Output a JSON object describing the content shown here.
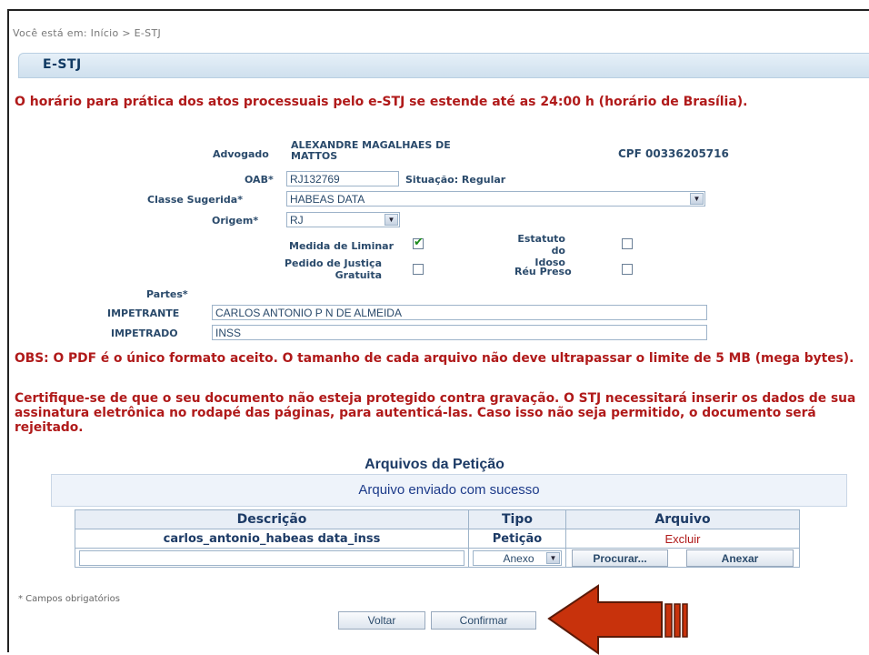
{
  "breadcrumb": "Você está em: Início > E-STJ",
  "panel_title": "E-STJ",
  "notice_schedule": "O horário para prática dos atos processuais pelo e-STJ se estende até as 24:00 h (horário de Brasília).",
  "lawyer": {
    "label": "Advogado",
    "name_line1": "ALEXANDRE MAGALHAES DE",
    "name_line2": "MATTOS",
    "cpf_label": "CPF",
    "cpf": "00336205716"
  },
  "oab": {
    "label": "OAB*",
    "value": "RJ132769",
    "situacao": "Situação: Regular"
  },
  "classe": {
    "label": "Classe Sugerida*",
    "value": "HABEAS DATA"
  },
  "origem": {
    "label": "Origem*",
    "value": "RJ"
  },
  "checks": {
    "medida_liminar": {
      "label": "Medida de Liminar",
      "checked": true
    },
    "estatuto_idoso": {
      "label1": "Estatuto do",
      "label2": "Idoso",
      "checked": false
    },
    "justica_gratuita": {
      "label1": "Pedido de Justiça",
      "label2": "Gratuita",
      "checked": false
    },
    "reu_preso": {
      "label": "Réu Preso",
      "checked": false
    }
  },
  "partes": {
    "label": "Partes*",
    "impetrante_label": "IMPETRANTE",
    "impetrante_value": "CARLOS ANTONIO P N DE ALMEIDA",
    "impetrado_label": "IMPETRADO",
    "impetrado_value": "INSS"
  },
  "obs_pdf": "OBS: O PDF é o único formato aceito. O tamanho de cada arquivo não deve ultrapassar o limite de 5 MB (mega bytes).",
  "certifique": "Certifique-se de que o seu documento não esteja protegido contra gravação. O STJ necessitará inserir os dados de sua assinatura eletrônica no rodapé das páginas, para autenticá-las. Caso isso não seja permitido, o documento será rejeitado.",
  "files": {
    "title": "Arquivos da Petição",
    "success": "Arquivo enviado com sucesso",
    "headers": [
      "Descrição",
      "Tipo",
      "Arquivo"
    ],
    "row": {
      "descricao": "carlos_antonio_habeas data_inss",
      "tipo": "Petição",
      "acao": "Excluir"
    },
    "new_tipo": "Anexo",
    "procurar": "Procurar...",
    "anexar": "Anexar"
  },
  "required_note": "* Campos obrigatórios",
  "buttons": {
    "voltar": "Voltar",
    "confirmar": "Confirmar"
  },
  "colors": {
    "notice_red": "#b01a1a",
    "header_blue": "#1d3b66",
    "arrow_red": "#c8320c"
  }
}
